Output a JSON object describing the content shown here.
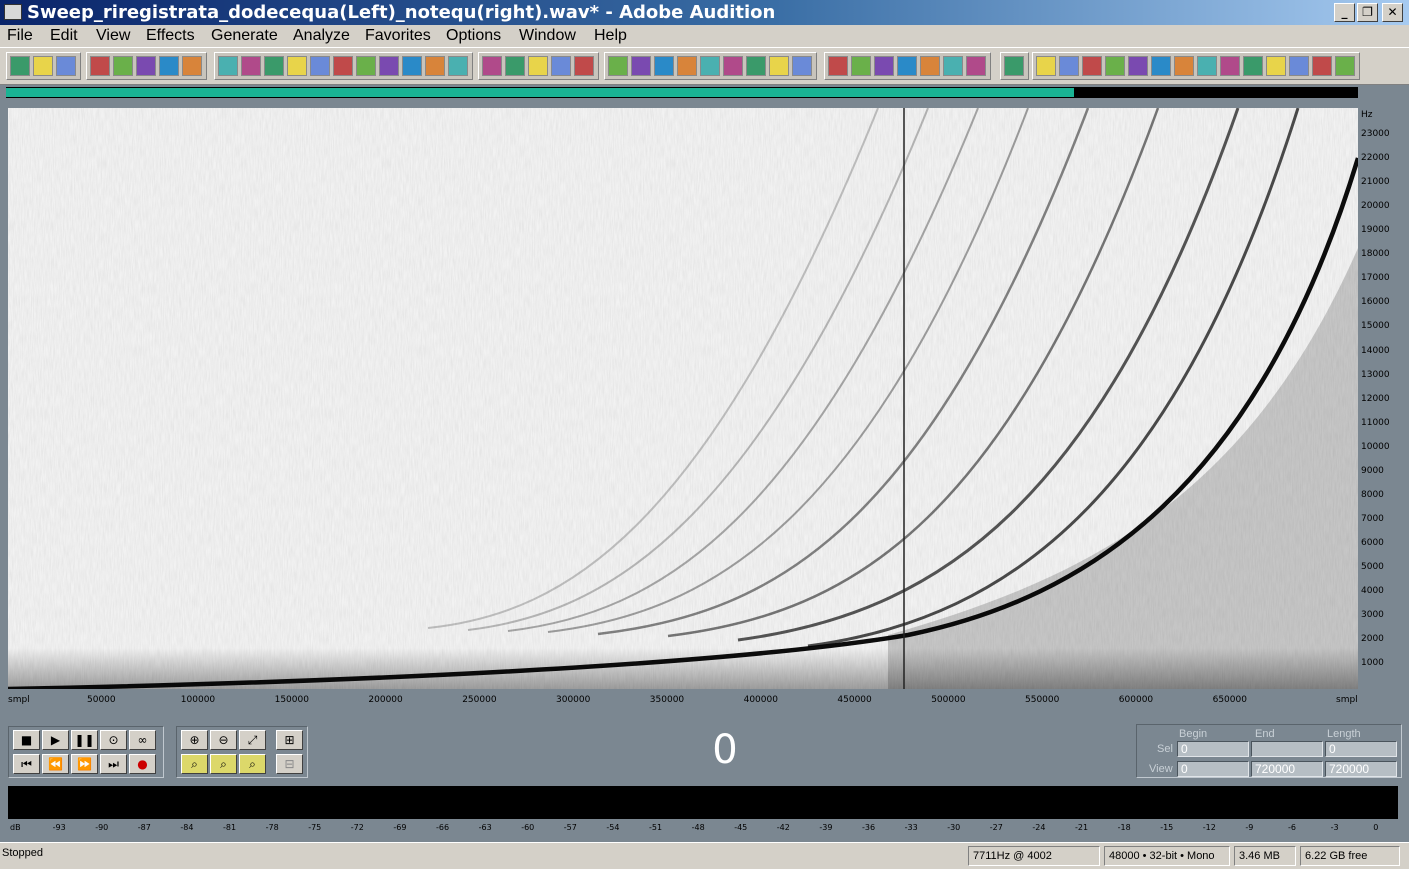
{
  "window": {
    "title": "Sweep_riregistrata_dodecequa(Left)_notequ(right).wav* - Adobe Audition",
    "controls": {
      "minimize": "_",
      "restore": "❐",
      "close": "✕"
    }
  },
  "menu": [
    "File",
    "Edit",
    "View",
    "Effects",
    "Generate",
    "Analyze",
    "Favorites",
    "Options",
    "Window",
    "Help"
  ],
  "toolbar": {
    "icons": [
      "multitrack-view-icon",
      "edit-view-icon",
      "cd-view-icon",
      "new-file-icon",
      "open-file-icon",
      "save-icon",
      "save-all-icon",
      "close-file-icon",
      "undo-icon",
      "redo-icon",
      "cut-icon",
      "copy-icon",
      "paste-icon",
      "mix-paste-icon",
      "trim-icon",
      "insert-icon",
      "snapshot-icon",
      "mark-icon",
      "spectral-view-icon",
      "waveform-view-icon",
      "phase-icon",
      "pan-icon",
      "frequency-icon",
      "time-icon",
      "zoom-icon",
      "scrub-icon",
      "lasso-icon",
      "loop-icon",
      "effects-icon",
      "filter-icon",
      "reverb-icon",
      "delay-icon",
      "envelope-icon",
      "marker-icon",
      "analysis-icon",
      "ap-icon",
      "voice-icon",
      "vb-icon",
      "noise-icon",
      "harmonic-icon",
      "fft-icon",
      "level-icon",
      "bars-icon",
      "hum-icon",
      "itu-p56-icon",
      "sti-icon",
      "wave-icon"
    ]
  },
  "overview": {
    "progress": 0.79
  },
  "spectrogram": {
    "freq_unit": "Hz",
    "freq_ticks": [
      "23000",
      "22000",
      "21000",
      "20000",
      "19000",
      "18000",
      "17000",
      "16000",
      "15000",
      "14000",
      "13000",
      "12000",
      "11000",
      "10000",
      "9000",
      "8000",
      "7000",
      "6000",
      "5000",
      "4000",
      "3000",
      "2000",
      "1000"
    ],
    "time_unit": "smpl",
    "time_ticks": [
      "50000",
      "100000",
      "150000",
      "200000",
      "250000",
      "300000",
      "350000",
      "400000",
      "450000",
      "500000",
      "550000",
      "600000",
      "650000"
    ],
    "cursor_sample": 480000
  },
  "transport": {
    "buttons": [
      "stop",
      "play",
      "pause",
      "play-to-end",
      "loop"
    ],
    "buttons2": [
      "go-to-start",
      "rewind",
      "fast-forward",
      "go-to-end",
      "record"
    ],
    "zoom": [
      "zoom-in-icon",
      "zoom-out-icon",
      "zoom-full-icon",
      "zoom-sel-icon",
      "zoom-left-icon",
      "zoom-right-icon",
      "zoom-in-vertical-icon",
      "zoom-out-vertical-icon"
    ],
    "time_value": "0"
  },
  "selection": {
    "headers": {
      "begin": "Begin",
      "end": "End",
      "length": "Length"
    },
    "sel_label": "Sel",
    "view_label": "View",
    "sel": {
      "begin": "0",
      "end": "",
      "length": "0"
    },
    "view": {
      "begin": "0",
      "end": "720000",
      "length": "720000"
    }
  },
  "meter": {
    "ticks": [
      "dB",
      "-93",
      "-90",
      "-87",
      "-84",
      "-81",
      "-78",
      "-75",
      "-72",
      "-69",
      "-66",
      "-63",
      "-60",
      "-57",
      "-54",
      "-51",
      "-48",
      "-45",
      "-42",
      "-39",
      "-36",
      "-33",
      "-30",
      "-27",
      "-24",
      "-21",
      "-18",
      "-15",
      "-12",
      "-9",
      "-6",
      "-3",
      "0"
    ]
  },
  "status": {
    "state": "Stopped",
    "cursor": "7711Hz @ 4002",
    "format": "48000 • 32-bit • Mono",
    "size": "3.46 MB",
    "free": "6.22 GB free"
  }
}
